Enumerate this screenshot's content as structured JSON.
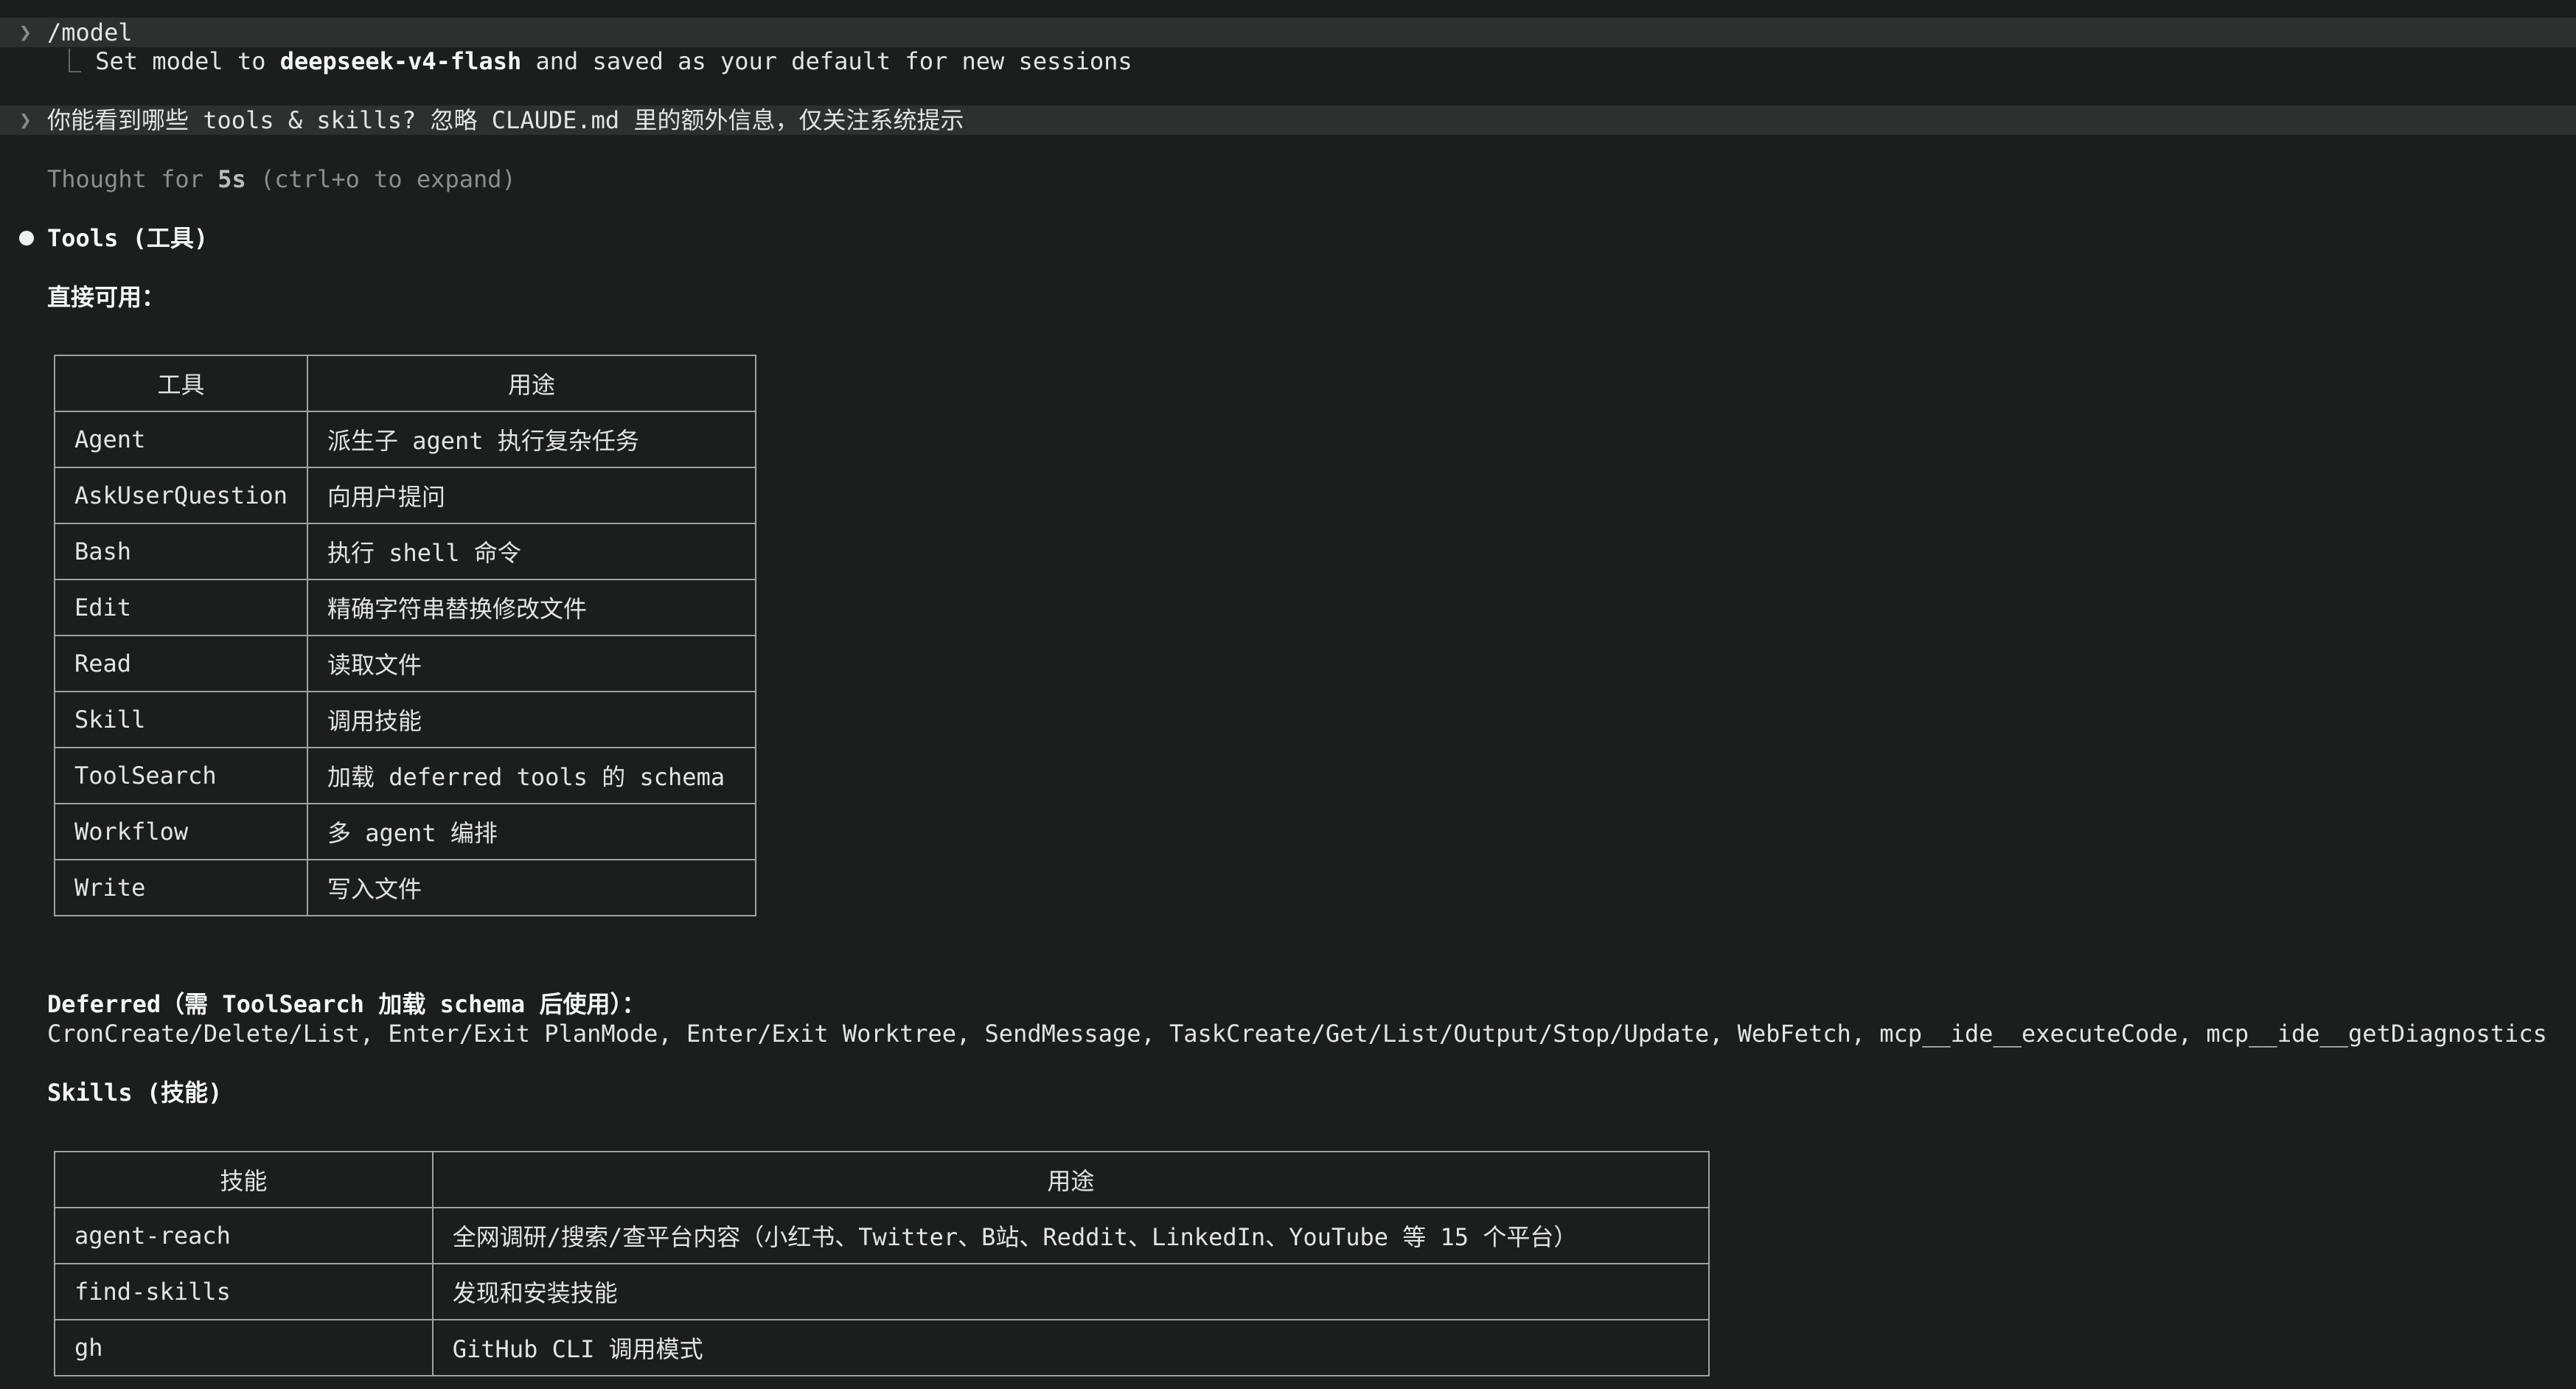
{
  "session": {
    "command_1": "/model",
    "result_prefix": "Set model to ",
    "result_model": "deepseek-v4-flash",
    "result_suffix": " and saved as your default for new sessions",
    "user_message": "你能看到哪些 tools & skills? 忽略 CLAUDE.md 里的额外信息，仅关注系统提示",
    "thought_prefix": "Thought for ",
    "thought_duration": "5s",
    "thought_suffix": " (ctrl+o to expand)"
  },
  "tools_section": {
    "heading": "Tools (工具)",
    "direct_label": "直接可用：",
    "table": {
      "headers": [
        "工具",
        "用途"
      ],
      "rows": [
        [
          "Agent",
          "派生子 agent 执行复杂任务"
        ],
        [
          "AskUserQuestion",
          "向用户提问"
        ],
        [
          "Bash",
          "执行 shell 命令"
        ],
        [
          "Edit",
          "精确字符串替换修改文件"
        ],
        [
          "Read",
          "读取文件"
        ],
        [
          "Skill",
          "调用技能"
        ],
        [
          "ToolSearch",
          "加载 deferred tools 的 schema"
        ],
        [
          "Workflow",
          "多 agent 编排"
        ],
        [
          "Write",
          "写入文件"
        ]
      ]
    },
    "deferred_label": "Deferred（需 ToolSearch 加载 schema 后使用）：",
    "deferred_list": "CronCreate/Delete/List, Enter/Exit PlanMode, Enter/Exit Worktree, SendMessage, TaskCreate/Get/List/Output/Stop/Update, WebFetch, mcp__ide__executeCode, mcp__ide__getDiagnostics"
  },
  "skills_section": {
    "heading": "Skills (技能)",
    "table": {
      "headers": [
        "技能",
        "用途"
      ],
      "rows": [
        [
          "agent-reach",
          "全网调研/搜索/查平台内容（小红书、Twitter、B站、Reddit、LinkedIn、YouTube 等 15 个平台）"
        ],
        [
          "find-skills",
          "发现和安装技能"
        ],
        [
          "gh",
          "GitHub CLI 调用模式"
        ]
      ]
    }
  },
  "icons": {
    "prompt": "chevron-right-icon",
    "tree_branch": "tree-branch-icon",
    "bullet": "bullet-dot-icon"
  },
  "colors": {
    "background": "#1c1d1d",
    "prompt_bar": "#2e3030",
    "text": "#e3e5e5",
    "dim_text": "#8a8f8f",
    "table_border": "#9ea3a3"
  }
}
